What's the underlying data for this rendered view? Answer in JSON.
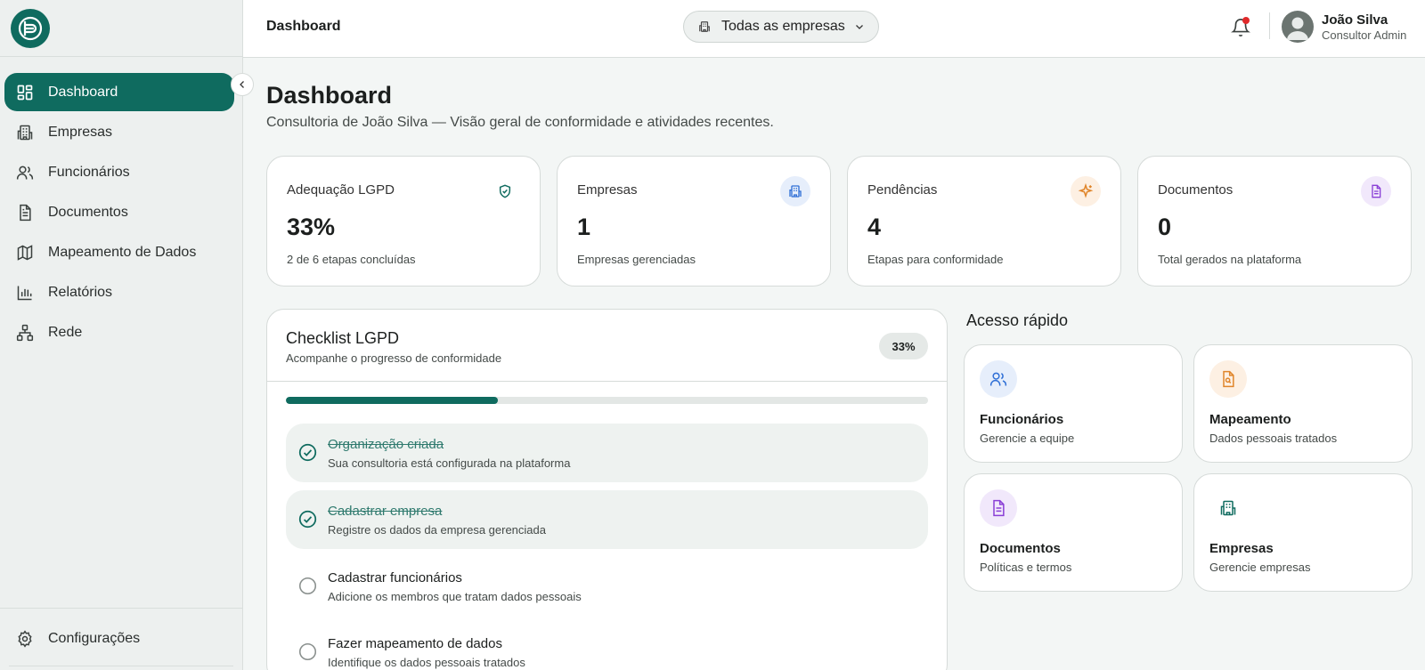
{
  "colors": {
    "brand": "#0f6b5f",
    "blue": "#2f6fd6",
    "orange": "#e0852a",
    "purple": "#8a3fd6",
    "notification": "#e0292a"
  },
  "sidebar": {
    "items": [
      {
        "label": "Dashboard",
        "icon": "dashboard-icon"
      },
      {
        "label": "Empresas",
        "icon": "building-icon"
      },
      {
        "label": "Funcionários",
        "icon": "users-icon"
      },
      {
        "label": "Documentos",
        "icon": "document-icon"
      },
      {
        "label": "Mapeamento de Dados",
        "icon": "map-icon"
      },
      {
        "label": "Relatórios",
        "icon": "bar-chart-icon"
      },
      {
        "label": "Rede",
        "icon": "network-icon"
      }
    ],
    "settings_label": "Configurações"
  },
  "header": {
    "title": "Dashboard",
    "company_select": "Todas as empresas",
    "user_name": "João Silva",
    "user_role": "Consultor Admin"
  },
  "main": {
    "title": "Dashboard",
    "subtitle": "Consultoria de João Silva — Visão geral de conformidade e atividades recentes."
  },
  "stats": [
    {
      "label": "Adequação LGPD",
      "value": "33%",
      "desc": "2 de 6 etapas concluídas",
      "icon": "shield-check-icon"
    },
    {
      "label": "Empresas",
      "value": "1",
      "desc": "Empresas gerenciadas",
      "icon": "building-icon"
    },
    {
      "label": "Pendências",
      "value": "4",
      "desc": "Etapas para conformidade",
      "icon": "sparkle-icon"
    },
    {
      "label": "Documentos",
      "value": "0",
      "desc": "Total gerados na plataforma",
      "icon": "document-icon"
    }
  ],
  "checklist": {
    "title": "Checklist LGPD",
    "subtitle": "Acompanhe o progresso de conformidade",
    "badge": "33%",
    "progress": 0.33,
    "items": [
      {
        "title": "Organização criada",
        "desc": "Sua consultoria está configurada na plataforma",
        "done": true
      },
      {
        "title": "Cadastrar empresa",
        "desc": "Registre os dados da empresa gerenciada",
        "done": true
      },
      {
        "title": "Cadastrar funcionários",
        "desc": "Adicione os membros que tratam dados pessoais",
        "done": false
      },
      {
        "title": "Fazer mapeamento de dados",
        "desc": "Identifique os dados pessoais tratados",
        "done": false
      }
    ]
  },
  "quick_access": {
    "title": "Acesso rápido",
    "items": [
      {
        "label": "Funcionários",
        "desc": "Gerencie a equipe",
        "icon": "users-icon"
      },
      {
        "label": "Mapeamento",
        "desc": "Dados pessoais tratados",
        "icon": "file-search-icon"
      },
      {
        "label": "Documentos",
        "desc": "Políticas e termos",
        "icon": "document-icon"
      },
      {
        "label": "Empresas",
        "desc": "Gerencie empresas",
        "icon": "building-icon"
      }
    ]
  }
}
